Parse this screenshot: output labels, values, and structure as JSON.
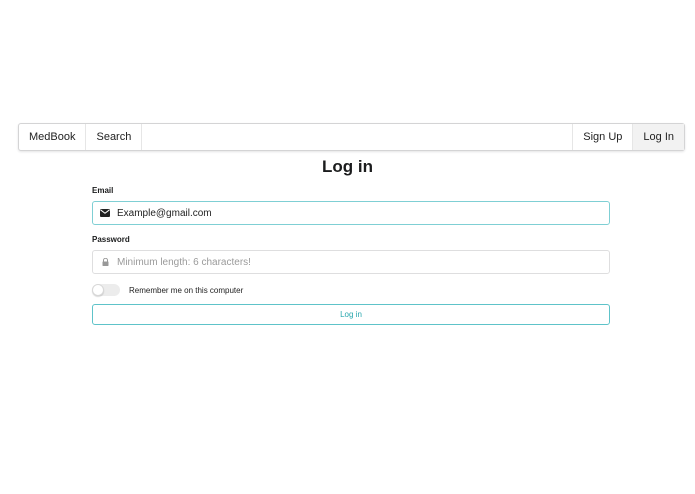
{
  "navbar": {
    "brand": "MedBook",
    "search": "Search",
    "sign_up": "Sign Up",
    "log_in": "Log In"
  },
  "page": {
    "title": "Log in"
  },
  "form": {
    "email_label": "Email",
    "email_value": "Example@gmail.com",
    "email_icon": "envelope-icon",
    "password_label": "Password",
    "password_value": "",
    "password_placeholder": "Minimum length: 6 characters!",
    "password_icon": "lock-icon",
    "remember_label": "Remember me on this computer",
    "remember_checked": false,
    "submit_label": "Log in"
  },
  "colors": {
    "accent": "#27a6ad",
    "focus_border": "#7fcfd4"
  }
}
